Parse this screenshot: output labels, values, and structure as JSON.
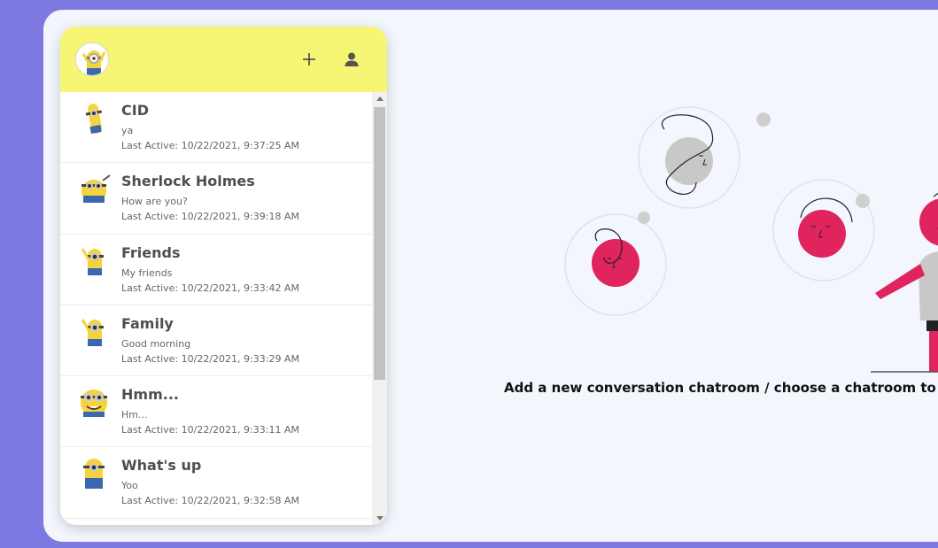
{
  "sidebar": {
    "header": {
      "add_icon": "plus-icon",
      "profile_icon": "person-icon"
    },
    "chats": [
      {
        "name": "CID",
        "last_message": "ya",
        "last_active": "Last Active: 10/22/2021, 9:37:25 AM"
      },
      {
        "name": "Sherlock Holmes",
        "last_message": "How are you?",
        "last_active": "Last Active: 10/22/2021, 9:39:18 AM"
      },
      {
        "name": "Friends",
        "last_message": "My friends",
        "last_active": "Last Active: 10/22/2021, 9:33:42 AM"
      },
      {
        "name": "Family",
        "last_message": "Good morning",
        "last_active": "Last Active: 10/22/2021, 9:33:29 AM"
      },
      {
        "name": "Hmm...",
        "last_message": "Hm...",
        "last_active": "Last Active: 10/22/2021, 9:33:11 AM"
      },
      {
        "name": "What's up",
        "last_message": "Yoo",
        "last_active": "Last Active: 10/22/2021, 9:32:58 AM"
      }
    ]
  },
  "main": {
    "empty_message": "Add a new conversation chatroom / choose a chatroom to start"
  },
  "colors": {
    "background": "#7d79e1",
    "header": "#f6f674",
    "accent": "#e0245e"
  }
}
